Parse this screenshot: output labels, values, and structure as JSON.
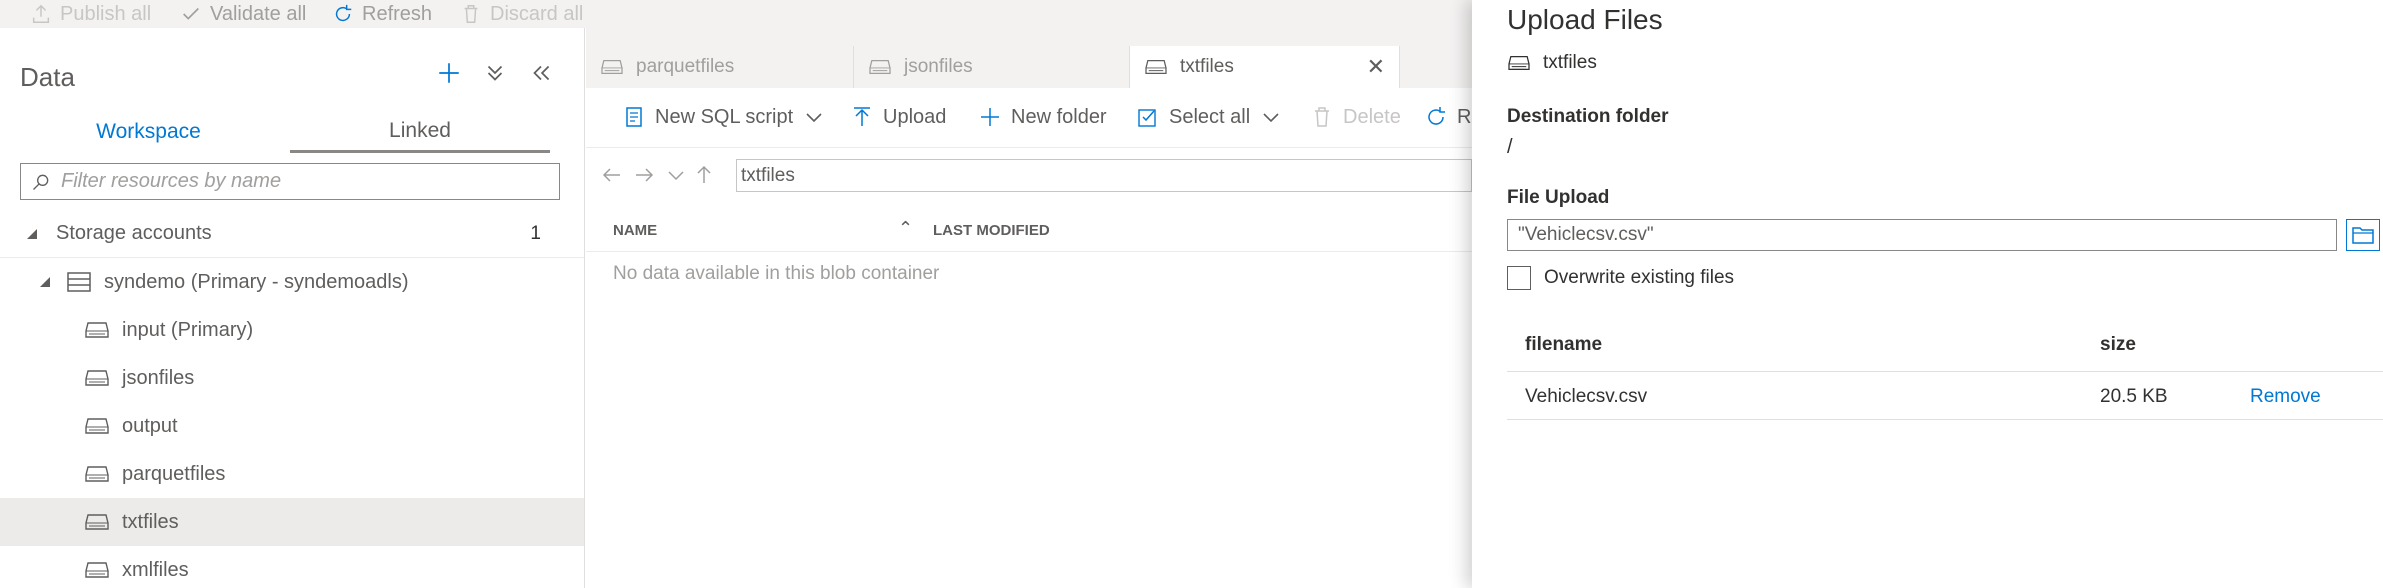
{
  "toolbar": {
    "publish_all": "Publish all",
    "validate_all": "Validate all",
    "refresh": "Refresh",
    "discard_all": "Discard all"
  },
  "data_pane": {
    "title": "Data",
    "tabs": [
      "Workspace",
      "Linked"
    ],
    "active_tab": "Linked",
    "filter_placeholder": "Filter resources by name",
    "storage_section": {
      "label": "Storage accounts",
      "count": "1"
    },
    "account": {
      "label": "syndemo (Primary - syndemoadls)"
    },
    "containers": [
      {
        "label": "input (Primary)",
        "selected": false
      },
      {
        "label": "jsonfiles",
        "selected": false
      },
      {
        "label": "output",
        "selected": false
      },
      {
        "label": "parquetfiles",
        "selected": false
      },
      {
        "label": "txtfiles",
        "selected": true
      },
      {
        "label": "xmlfiles",
        "selected": false
      }
    ]
  },
  "doc_tabs": [
    {
      "label": "parquetfiles",
      "active": false
    },
    {
      "label": "jsonfiles",
      "active": false
    },
    {
      "label": "txtfiles",
      "active": true
    }
  ],
  "commands": {
    "new_sql_script": "New SQL script",
    "upload": "Upload",
    "new_folder": "New folder",
    "select_all": "Select all",
    "delete": "Delete",
    "refresh_partial": "R"
  },
  "path": {
    "value": "txtfiles"
  },
  "grid": {
    "columns": [
      "NAME",
      "LAST MODIFIED"
    ],
    "empty_message": "No data available in this blob container"
  },
  "upload_panel": {
    "title": "Upload Files",
    "container": "txtfiles",
    "destination_label": "Destination folder",
    "destination_value": "/",
    "file_upload_label": "File Upload",
    "file_upload_value": "\"Vehiclecsv.csv\"",
    "overwrite_label": "Overwrite existing files",
    "overwrite_checked": false,
    "table": {
      "headers": [
        "filename",
        "size"
      ],
      "rows": [
        {
          "filename": "Vehiclecsv.csv",
          "size": "20.5 KB",
          "action": "Remove"
        }
      ]
    }
  },
  "colors": {
    "accent": "#0078d4",
    "selected_row": "#edebe9",
    "toolbar_bg": "#f3f2f1"
  }
}
